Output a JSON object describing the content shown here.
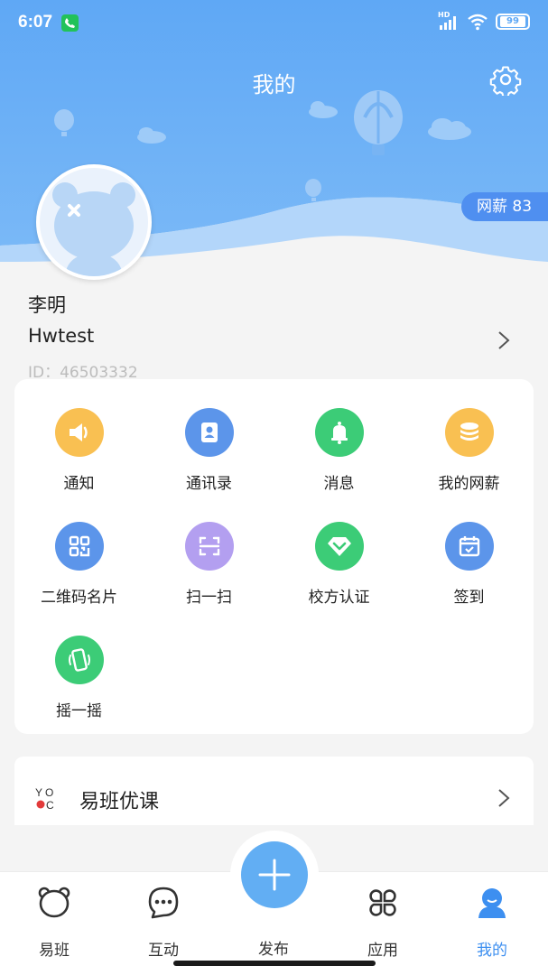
{
  "status_bar": {
    "time": "6:07",
    "network": "HD",
    "battery": "99"
  },
  "header": {
    "title": "我的",
    "salary_badge": "网薪 83"
  },
  "profile": {
    "name": "李明",
    "school": "Hwtest",
    "id_text": "ID：46503332"
  },
  "grid": [
    {
      "label": "通知",
      "icon": "speaker-icon",
      "color": "#f9c052"
    },
    {
      "label": "通讯录",
      "icon": "contacts-icon",
      "color": "#5c95ea"
    },
    {
      "label": "消息",
      "icon": "bell-icon",
      "color": "#3ccc77"
    },
    {
      "label": "我的网薪",
      "icon": "coins-icon",
      "color": "#f9c052"
    },
    {
      "label": "二维码名片",
      "icon": "qrcode-icon",
      "color": "#5c95ea"
    },
    {
      "label": "扫一扫",
      "icon": "scan-icon",
      "color": "#b39ff0"
    },
    {
      "label": "校方认证",
      "icon": "verify-diamond-icon",
      "color": "#3ccc77"
    },
    {
      "label": "签到",
      "icon": "calendar-check-icon",
      "color": "#5c95ea"
    },
    {
      "label": "摇一摇",
      "icon": "shake-phone-icon",
      "color": "#3ccc77"
    }
  ],
  "course": {
    "label": "易班优课",
    "logo_text": "YO OC"
  },
  "tabs": [
    {
      "label": "易班",
      "icon": "bear-face-icon"
    },
    {
      "label": "互动",
      "icon": "chat-bubble-icon"
    },
    {
      "label": "发布",
      "icon": "plus-icon"
    },
    {
      "label": "应用",
      "icon": "apps-clover-icon"
    },
    {
      "label": "我的",
      "icon": "person-icon",
      "active": true
    }
  ],
  "colors": {
    "header_blue": "#5fa8f5",
    "active_tab": "#3d8ff0",
    "fab": "#62aef3"
  }
}
